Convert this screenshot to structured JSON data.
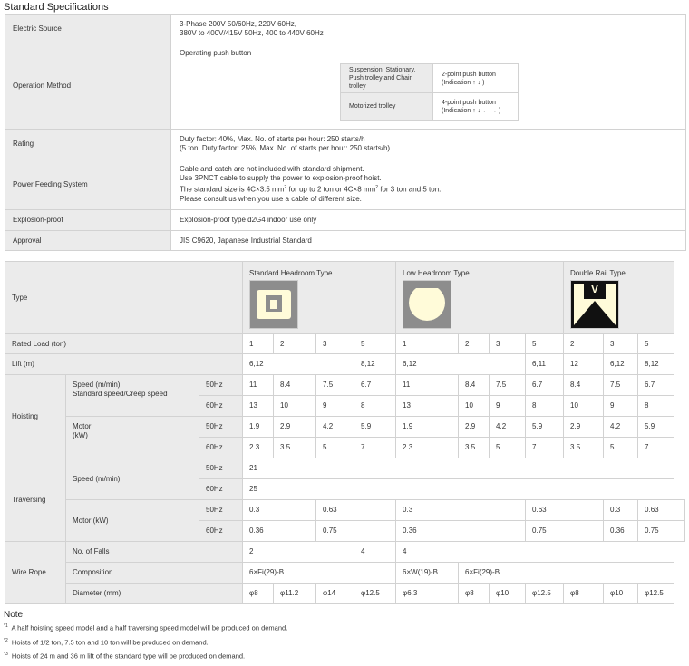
{
  "spec": {
    "title": "Standard Specifications",
    "electric_label": "Electric Source",
    "electric_line1": "3-Phase 200V 50/60Hz, 220V 60Hz,",
    "electric_line2": "380V to 400V/415V 50Hz, 400 to 440V 60Hz",
    "op_label": "Operation Method",
    "op_main": "Operating push button",
    "op_sub1_label_a": "Suspension, Stationary,",
    "op_sub1_label_b": "Push trolley and Chain trolley",
    "op_sub1_val_a": "2-point push button",
    "op_sub1_val_b": "(Indication ↑ ↓ )",
    "op_sub2_label": "Motorized trolley",
    "op_sub2_val_a": "4-point push button",
    "op_sub2_val_b": "(Indication ↑ ↓ ← → )",
    "rating_label": "Rating",
    "rating_line1": "Duty factor: 40%, Max. No. of starts per hour: 250 starts/h",
    "rating_line2": "(5 ton: Duty factor: 25%, Max. No. of starts per hour: 250 starts/h)",
    "power_label": "Power Feeding System",
    "power_line1": "Cable and catch are not included with standard shipment.",
    "power_line2": "Use 3PNCT cable to supply the power to explosion-proof hoist.",
    "power_line3a": "The standard size is 4C×3.5 mm",
    "power_line3b": " for up to 2 ton or 4C×8 mm",
    "power_line3c": " for 3 ton and 5 ton.",
    "power_sup": "2",
    "power_line4": "Please consult us when you use a cable of different size.",
    "explosion_label": "Explosion-proof",
    "explosion_val": "Explosion-proof type d2G4 indoor use only",
    "approval_label": "Approval",
    "approval_val": "JIS C9620, Japanese Industrial Standard"
  },
  "main": {
    "type_label": "Type",
    "type_std": "Standard Headroom Type",
    "type_low": "Low Headroom Type",
    "type_rail": "Double Rail Type",
    "rail_icon_letter": "V",
    "rated_label": "Rated Load (ton)",
    "rated": [
      "1",
      "2",
      "3",
      "5",
      "1",
      "2",
      "3",
      "5",
      "2",
      "3",
      "5"
    ],
    "lift_label": "Lift (m)",
    "lift": {
      "std_a": "6,12",
      "std_b": "8,12",
      "low_a": "6,12",
      "low_b": "6,11",
      "rail_a": "12",
      "rail_b": "6,12",
      "rail_c": "8,12"
    },
    "hoisting_label": "Hoisting",
    "speed_label_a": "Speed (m/min)",
    "speed_label_b": "Standard speed/Creep speed",
    "motor_label_a": "Motor",
    "motor_label_b": "(kW)",
    "hz50": "50Hz",
    "hz60": "60Hz",
    "hoist_speed_50": [
      "11",
      "8.4",
      "7.5",
      "6.7",
      "11",
      "8.4",
      "7.5",
      "6.7",
      "8.4",
      "7.5",
      "6.7"
    ],
    "hoist_speed_60": [
      "13",
      "10",
      "9",
      "8",
      "13",
      "10",
      "9",
      "8",
      "10",
      "9",
      "8"
    ],
    "hoist_motor_50": [
      "1.9",
      "2.9",
      "4.2",
      "5.9",
      "1.9",
      "2.9",
      "4.2",
      "5.9",
      "2.9",
      "4.2",
      "5.9"
    ],
    "hoist_motor_60": [
      "2.3",
      "3.5",
      "5",
      "7",
      "2.3",
      "3.5",
      "5",
      "7",
      "3.5",
      "5",
      "7"
    ],
    "traversing_label": "Traversing",
    "trav_speed_label": "Speed (m/min)",
    "trav_motor_label": "Motor (kW)",
    "trav_speed_50": "21",
    "trav_speed_60": "25",
    "trav_motor_50": [
      "0.3",
      "0.63",
      "0.3",
      "0.63",
      "0.3",
      "0.63"
    ],
    "trav_motor_60": [
      "0.36",
      "0.75",
      "0.36",
      "0.75",
      "0.36",
      "0.75"
    ],
    "wire_label": "Wire Rope",
    "falls_label": "No. of Falls",
    "falls": [
      "2",
      "4",
      "4"
    ],
    "comp_label": "Composition",
    "comp": [
      "6×Fi(29)-B",
      "6×W(19)-B",
      "6×Fi(29)-B"
    ],
    "diam_label": "Diameter (mm)",
    "diam": [
      "φ8",
      "φ11.2",
      "φ14",
      "φ12.5",
      "φ6.3",
      "φ8",
      "φ10",
      "φ12.5",
      "φ8",
      "φ10",
      "φ12.5"
    ]
  },
  "notes": {
    "heading": "Note",
    "n1_mark": "*1",
    "n1": "A half hoisting speed model and a half traversing speed model will be produced on demand.",
    "n2_mark": "*2",
    "n2": "Hoists of 1/2 ton, 7.5 ton and 10 ton will be produced on demand.",
    "n3_mark": "*3",
    "n3": "Hoists of 24 m and 36 m lift of the standard type will be produced on demand."
  }
}
